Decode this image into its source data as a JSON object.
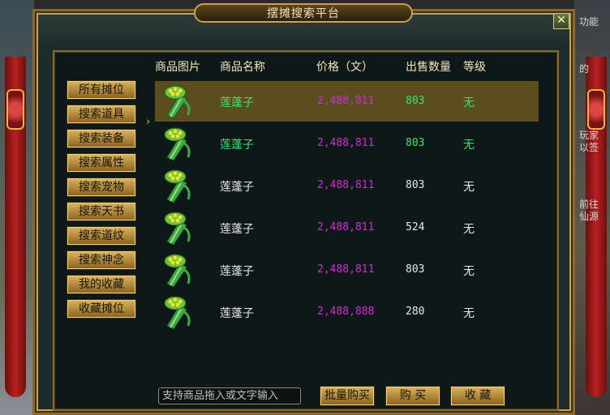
{
  "window": {
    "title": "摆摊搜索平台",
    "close_label": "✕"
  },
  "right_edge_texts": [
    "功能",
    "的",
    "玩家",
    "以签",
    "前往",
    "仙源"
  ],
  "sidebar": {
    "items": [
      {
        "label": "所有摊位"
      },
      {
        "label": "搜索道具"
      },
      {
        "label": "搜索装备"
      },
      {
        "label": "搜索属性"
      },
      {
        "label": "搜索宠物"
      },
      {
        "label": "搜索天书"
      },
      {
        "label": "搜索道纹"
      },
      {
        "label": "搜索神念"
      },
      {
        "label": "我的收藏"
      },
      {
        "label": "收藏摊位"
      }
    ]
  },
  "table": {
    "headers": {
      "image": "商品图片",
      "name": "商品名称",
      "price": "价格（文）",
      "qty": "出售数量",
      "grade": "等级"
    },
    "rows": [
      {
        "name": "莲蓬子",
        "price": "2,488,811",
        "qty": "803",
        "grade": "无",
        "highlight": true,
        "selected": true
      },
      {
        "name": "莲蓬子",
        "price": "2,488,811",
        "qty": "803",
        "grade": "无",
        "highlight": true,
        "selected": false
      },
      {
        "name": "莲蓬子",
        "price": "2,488,811",
        "qty": "803",
        "grade": "无",
        "highlight": false,
        "selected": false
      },
      {
        "name": "莲蓬子",
        "price": "2,488,811",
        "qty": "524",
        "grade": "无",
        "highlight": false,
        "selected": false
      },
      {
        "name": "莲蓬子",
        "price": "2,488,811",
        "qty": "803",
        "grade": "无",
        "highlight": false,
        "selected": false
      },
      {
        "name": "莲蓬子",
        "price": "2,488,888",
        "qty": "280",
        "grade": "无",
        "highlight": false,
        "selected": false
      }
    ]
  },
  "search": {
    "placeholder": "支持商品拖入或文字输入"
  },
  "actions": {
    "bulk_buy": "批量购买",
    "buy": "购 买",
    "favorite": "收 藏"
  },
  "colors": {
    "price": "#d12cd6",
    "highlight_green": "#43e36a",
    "gold": "#c9a34d",
    "selected_row": "#5a4e1e"
  },
  "icons": {
    "item_icon": "lotus-pod-icon",
    "selection_arrow": "selection-arrow-icon"
  }
}
